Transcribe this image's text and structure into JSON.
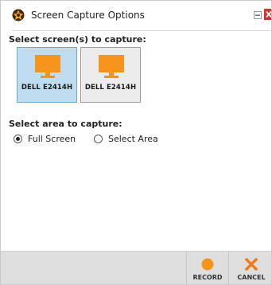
{
  "window": {
    "title": "Screen Capture Options"
  },
  "screens_section": {
    "label": "Select screen(s) to capture:",
    "monitors": [
      {
        "name": "DELL E2414H",
        "selected": true
      },
      {
        "name": "DELL E2414H",
        "selected": false
      }
    ]
  },
  "area_section": {
    "label": "Select area to capture:",
    "options": [
      {
        "label": "Full Screen",
        "selected": true
      },
      {
        "label": "Select Area",
        "selected": false
      }
    ]
  },
  "footer": {
    "record_label": "RECORD",
    "cancel_label": "CANCEL"
  },
  "colors": {
    "accent_orange": "#f7941d",
    "cancel_orange": "#f07a1a",
    "selected_tile_bg": "#bfdcf0",
    "selected_tile_border": "#6fa8d0",
    "close_red": "#d9302c"
  },
  "icons": {
    "app": "app-logo-icon",
    "minimize": "minimize-icon",
    "close": "close-icon",
    "monitor": "monitor-icon",
    "record": "record-icon",
    "cancel": "cancel-x-icon"
  }
}
